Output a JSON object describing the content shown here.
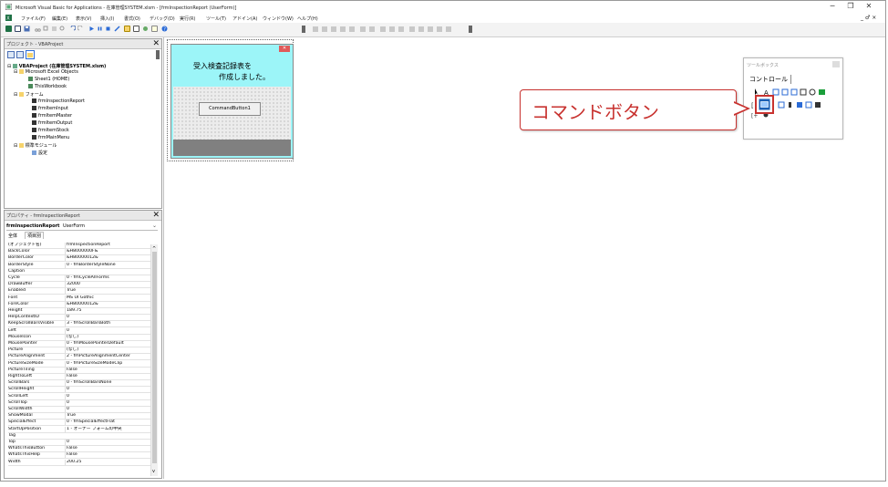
{
  "window": {
    "title": "Microsoft Visual Basic for Applications - 在庫管理SYSTEM.xlsm - [frmInspectionReport (UserForm)]",
    "controls": [
      "─",
      "❐",
      "✕"
    ],
    "inner_controls": "_ ♂ ×"
  },
  "menu": {
    "items": [
      "ファイル(F)",
      "編集(E)",
      "表示(V)",
      "挿入(I)",
      "書式(O)",
      "デバッグ(D)",
      "実行(R)",
      "ツール(T)",
      "アドイン(A)",
      "ウィンドウ(W)",
      "ヘルプ(H)"
    ]
  },
  "project_pane": {
    "title": "プロジェクト - VBAProject",
    "close": "✕",
    "tree": [
      {
        "label": "VBAProject (在庫管理SYSTEM.xlsm)",
        "bold": true
      },
      {
        "label": "Microsoft Excel Objects"
      },
      {
        "label": "Sheet1 (HOME)"
      },
      {
        "label": "ThisWorkbook"
      },
      {
        "label": "フォーム"
      },
      {
        "label": "frmInspectionReport"
      },
      {
        "label": "frmItemInput"
      },
      {
        "label": "frmItemMaster"
      },
      {
        "label": "frmItemOutput"
      },
      {
        "label": "frmItemStock"
      },
      {
        "label": "frmMainMenu"
      },
      {
        "label": "標準モジュール"
      },
      {
        "label": "設定"
      }
    ]
  },
  "properties_pane": {
    "title": "プロパティ - frmInspectionReport",
    "close": "✕",
    "object_name": "frmInspectionReport",
    "object_type": "UserForm",
    "tabs": [
      "全体",
      "項目別"
    ],
    "rows": [
      {
        "name": "(オブジェクト名)",
        "value": "frmInspectionReport"
      },
      {
        "name": "BackColor",
        "value": "&H8000000F&"
      },
      {
        "name": "BorderColor",
        "value": "&H80000012&"
      },
      {
        "name": "BorderStyle",
        "value": "0 - fmBorderStyleNone"
      },
      {
        "name": "Caption",
        "value": ""
      },
      {
        "name": "Cycle",
        "value": "0 - fmCycleAllForms"
      },
      {
        "name": "DrawBuffer",
        "value": "32000"
      },
      {
        "name": "Enabled",
        "value": "True"
      },
      {
        "name": "Font",
        "value": "MS UI Gothic"
      },
      {
        "name": "ForeColor",
        "value": "&H80000012&"
      },
      {
        "name": "Height",
        "value": "189.75"
      },
      {
        "name": "HelpContextID",
        "value": "0"
      },
      {
        "name": "KeepScrollBarsVisible",
        "value": "3 - fmScrollBarsBoth"
      },
      {
        "name": "Left",
        "value": "0"
      },
      {
        "name": "MouseIcon",
        "value": "(なし)"
      },
      {
        "name": "MousePointer",
        "value": "0 - fmMousePointerDefault"
      },
      {
        "name": "Picture",
        "value": "(なし)"
      },
      {
        "name": "PictureAlignment",
        "value": "2 - fmPictureAlignmentCenter"
      },
      {
        "name": "PictureSizeMode",
        "value": "0 - fmPictureSizeModeClip"
      },
      {
        "name": "PictureTiling",
        "value": "False"
      },
      {
        "name": "RightToLeft",
        "value": "False"
      },
      {
        "name": "ScrollBars",
        "value": "0 - fmScrollBarsNone"
      },
      {
        "name": "ScrollHeight",
        "value": "0"
      },
      {
        "name": "ScrollLeft",
        "value": "0"
      },
      {
        "name": "ScrollTop",
        "value": "0"
      },
      {
        "name": "ScrollWidth",
        "value": "0"
      },
      {
        "name": "ShowModal",
        "value": "True"
      },
      {
        "name": "SpecialEffect",
        "value": "0 - fmSpecialEffectFlat"
      },
      {
        "name": "StartUpPosition",
        "value": "1 - オーナー フォームの中央"
      },
      {
        "name": "Tag",
        "value": ""
      },
      {
        "name": "Top",
        "value": "0"
      },
      {
        "name": "WhatsThisButton",
        "value": "False"
      },
      {
        "name": "WhatsThisHelp",
        "value": "False"
      },
      {
        "name": "Width",
        "value": "200.25"
      }
    ]
  },
  "userform": {
    "label_line1": "受入検査記録表を",
    "label_line2": "作成しました。",
    "button_label": "CommandButton1",
    "close": "✕"
  },
  "toolbox": {
    "title": "ツールボックス",
    "tab": "コントロール"
  },
  "callout": {
    "text": "コマンドボタン"
  },
  "colors": {
    "label_bg": "#9cf5f8",
    "form_bottom": "#808080",
    "accent_red": "#c8322f",
    "highlight_blue": "#1a5fb4"
  }
}
